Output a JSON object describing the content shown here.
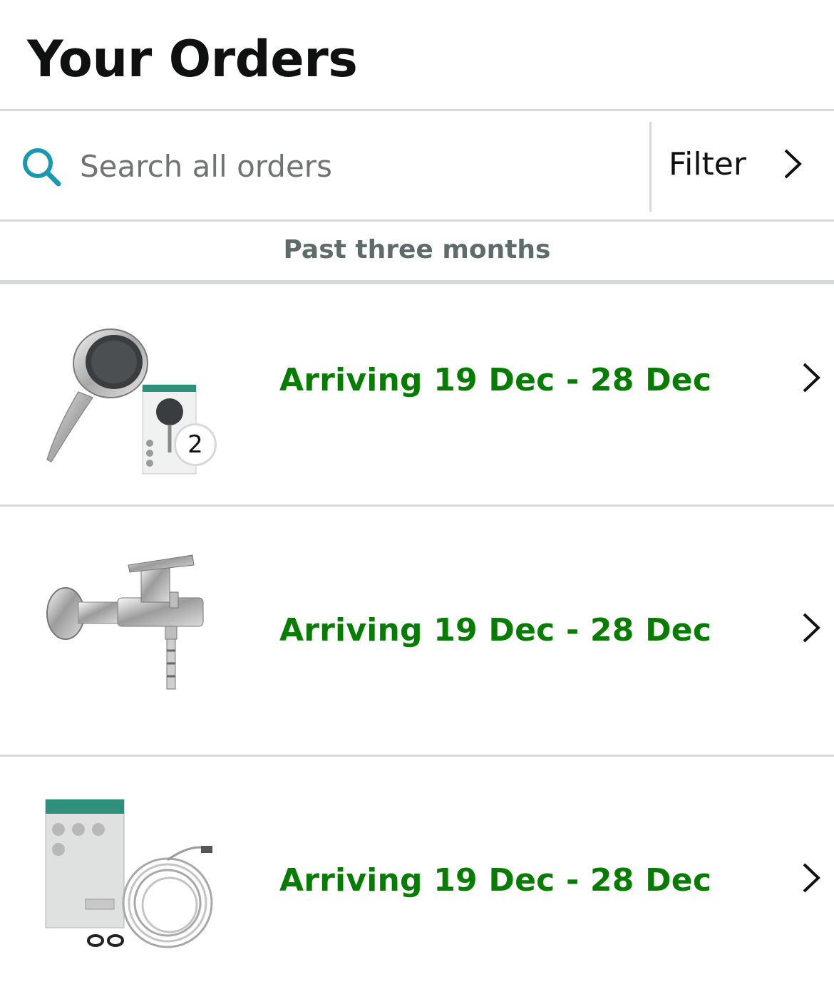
{
  "header": {
    "title": "Your Orders"
  },
  "search": {
    "placeholder": "Search all orders",
    "value": "",
    "icon": "search-icon"
  },
  "filter": {
    "label": "Filter",
    "icon": "chevron-right-icon"
  },
  "section": {
    "label": "Past three months"
  },
  "orders": [
    {
      "status": "Arriving 19 Dec - 28 Dec",
      "quantity": "2",
      "image": "hand-shower-icon"
    },
    {
      "status": "Arriving 19 Dec - 28 Dec",
      "image": "bath-mixer-tap-icon"
    },
    {
      "status": "Arriving 19 Dec - 28 Dec",
      "image": "shower-hose-icon"
    }
  ],
  "colors": {
    "status_green": "#067d00",
    "search_teal": "#1a98b0",
    "divider": "#d5d9d9",
    "text": "#0f1111"
  }
}
